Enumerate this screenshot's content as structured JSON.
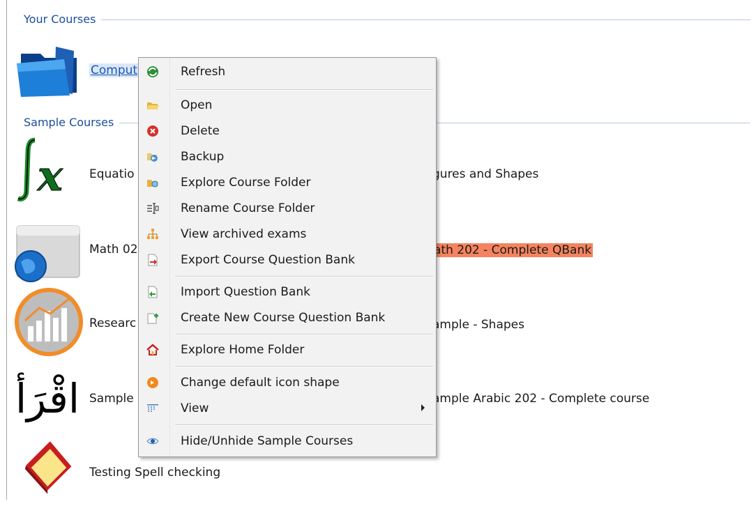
{
  "groups": {
    "your_courses": "Your Courses",
    "sample_courses": "Sample Courses"
  },
  "courses": {
    "computer": "Comput",
    "equations": "Equatio",
    "math": "Math 02",
    "research": "Researc",
    "sample": "Sample",
    "testing": "Testing Spell checking"
  },
  "right_items": {
    "figures": "gures and Shapes",
    "math202": "ath 202 - Complete QBank",
    "shapes": "ample - Shapes",
    "arabic": "ample Arabic 202 - Complete course"
  },
  "menu": {
    "refresh": "Refresh",
    "open": "Open",
    "delete": "Delete",
    "backup": "Backup",
    "explore_course": "Explore Course Folder",
    "rename": "Rename Course Folder",
    "archived": "View archived exams",
    "export": "Export Course Question Bank",
    "import": "Import Question Bank",
    "create_new": "Create New Course Question Bank",
    "explore_home": "Explore Home Folder",
    "change_icon": "Change default icon shape",
    "view": "View",
    "hide_samples": "Hide/Unhide Sample Courses"
  },
  "colors": {
    "highlight": "#f4845f",
    "group_header": "#1c4e9c",
    "selection": "#1a56b8"
  },
  "icons": [
    "folder-icon",
    "integral-fx-icon",
    "globe-window-icon",
    "chart-circle-icon",
    "arabic-iqra-icon",
    "red-book-icon",
    "refresh-icon",
    "open-folder-icon",
    "delete-icon",
    "backup-icon",
    "explore-icon",
    "rename-icon",
    "archive-icon",
    "export-icon",
    "import-icon",
    "create-new-icon",
    "home-icon",
    "change-shape-icon",
    "view-icon",
    "eye-icon"
  ]
}
